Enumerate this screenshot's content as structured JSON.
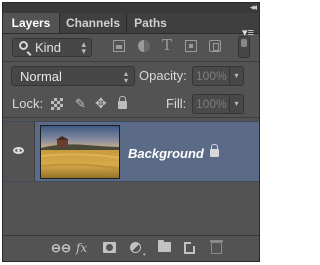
{
  "tabs": [
    {
      "label": "Layers"
    },
    {
      "label": "Channels"
    },
    {
      "label": "Paths"
    }
  ],
  "filter": {
    "kind_label": "Kind",
    "type_icon_glyph": "T"
  },
  "blend": {
    "mode": "Normal"
  },
  "opacity": {
    "label": "Opacity:",
    "value": "100%"
  },
  "lock": {
    "label": "Lock:"
  },
  "fill": {
    "label": "Fill:",
    "value": "100%"
  },
  "layers": [
    {
      "name": "Background",
      "visible": true,
      "locked": true
    }
  ],
  "footer": {
    "fx_label": "fx"
  },
  "colors": {
    "panel_bg": "#535353",
    "selected_layer": "#5b6b87",
    "tab_bar": "#3f3f3f"
  }
}
